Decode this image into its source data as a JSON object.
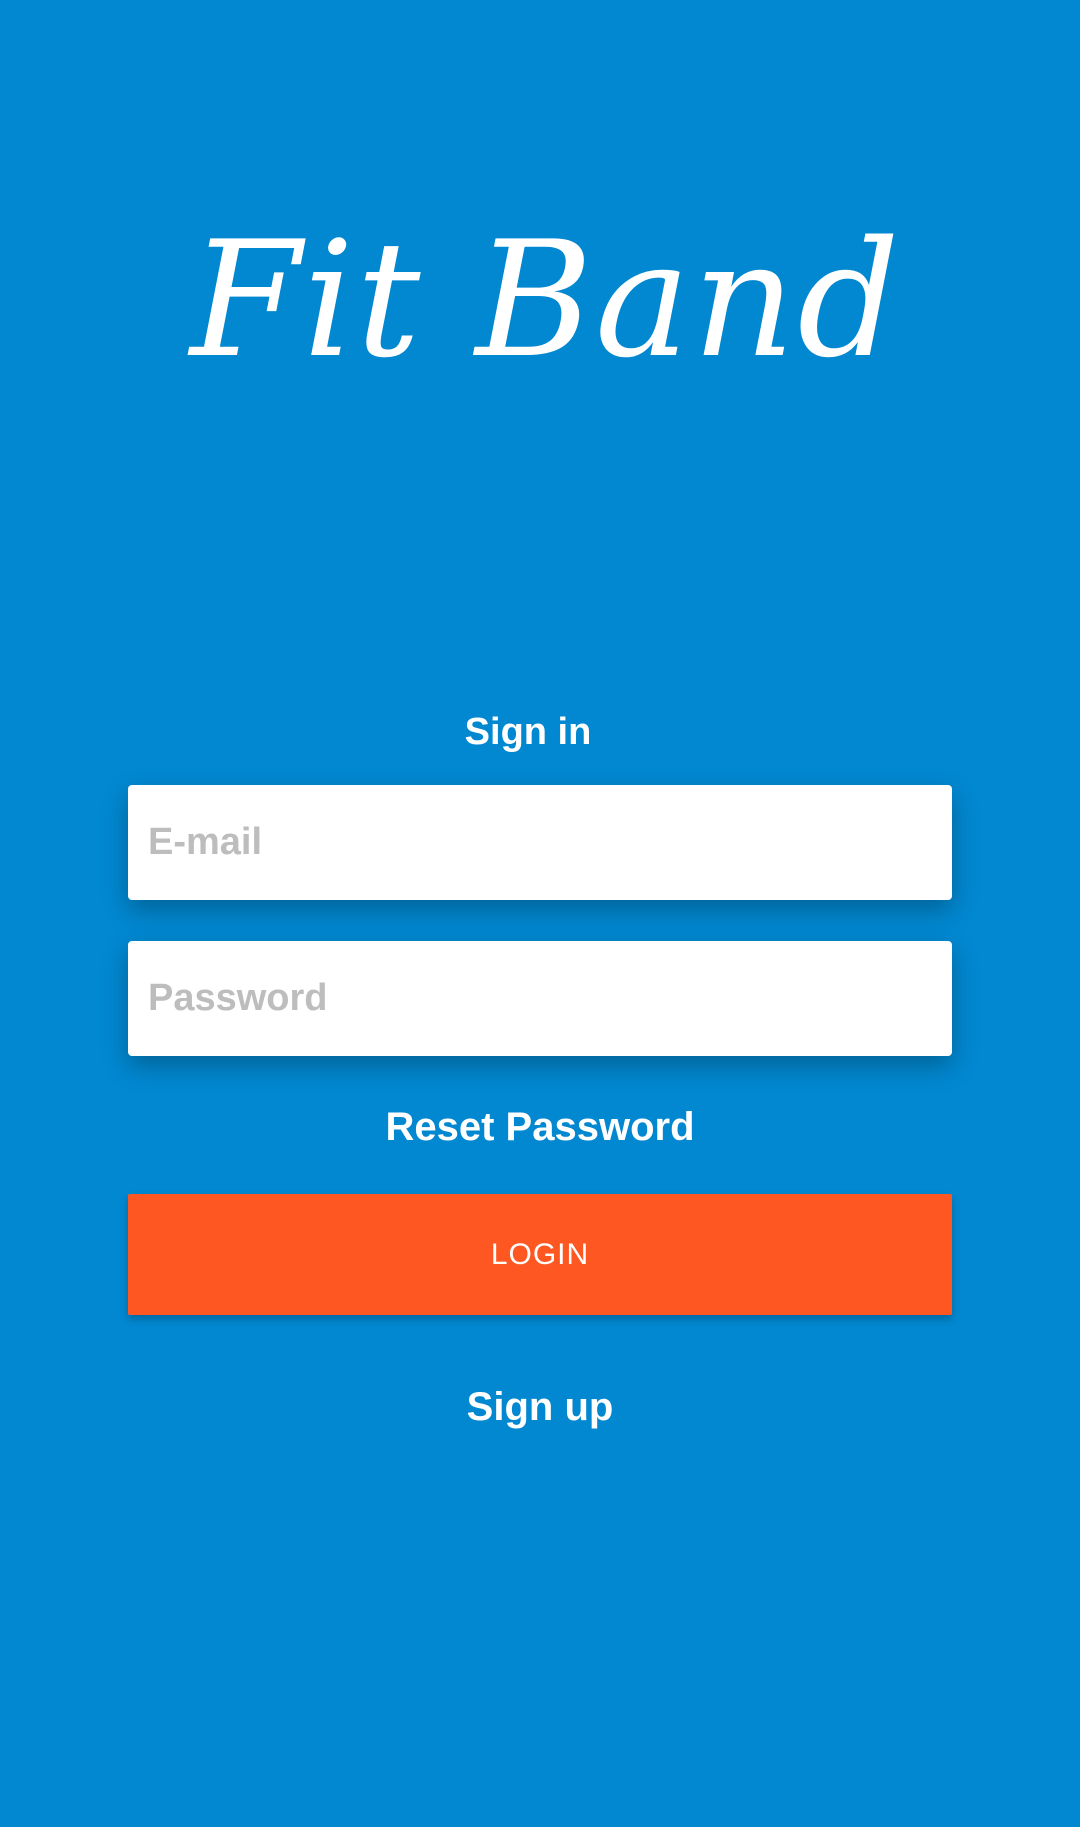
{
  "app": {
    "logo_text": "Fit Band"
  },
  "form": {
    "heading": "Sign in",
    "email": {
      "placeholder": "E-mail",
      "value": ""
    },
    "password": {
      "placeholder": "Password",
      "value": ""
    },
    "reset_label": "Reset Password",
    "login_label": "LOGIN",
    "signup_label": "Sign up"
  },
  "colors": {
    "background": "#0288D1",
    "accent": "#FF5722",
    "field_background": "#FFFFFF",
    "placeholder_text": "#BDBDBD",
    "text": "#FFFFFF"
  }
}
